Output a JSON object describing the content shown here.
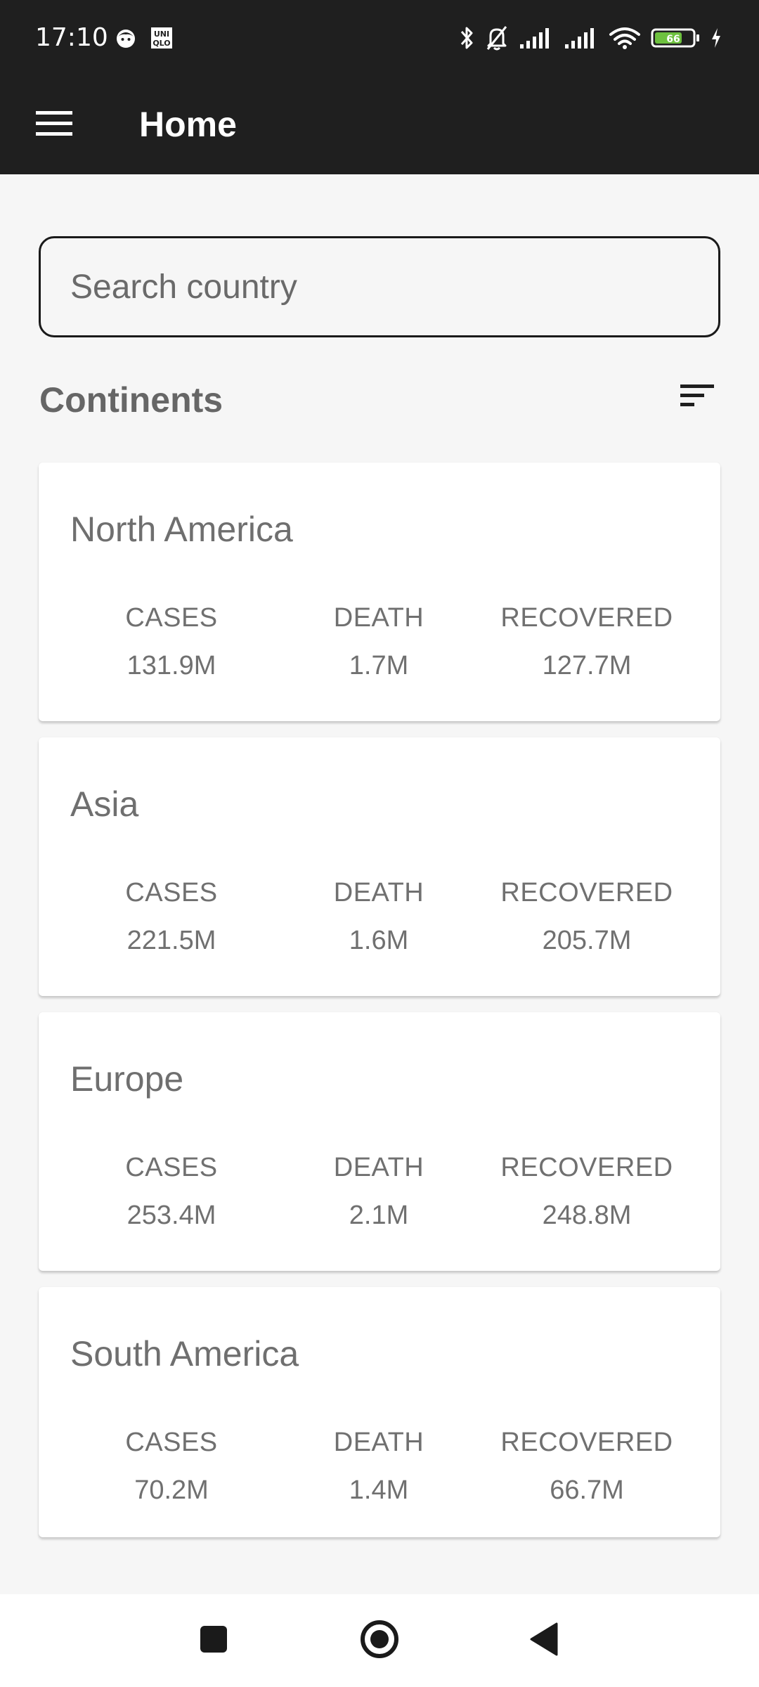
{
  "status_bar": {
    "time": "17:10",
    "left_icons": [
      "face-notification-icon",
      "uniqlo-notification-icon"
    ],
    "right_icons": [
      "bluetooth-icon",
      "bell-off-icon",
      "signal-icon",
      "signal-icon",
      "wifi-icon",
      "battery-icon",
      "charging-icon"
    ],
    "battery_level": "66",
    "battery_color": "#6ec13f",
    "uniqlo_text_top": "UNI",
    "uniqlo_text_bottom": "QLO"
  },
  "app_bar": {
    "title": "Home",
    "menu_icon": "hamburger-menu-icon"
  },
  "search": {
    "placeholder": "Search country",
    "value": ""
  },
  "section": {
    "title": "Continents",
    "sort_icon": "sort-icon"
  },
  "continents": [
    {
      "name": "North America",
      "cases_label": "CASES",
      "cases": "131.9M",
      "death_label": "DEATH",
      "death": "1.7M",
      "recovered_label": "RECOVERED",
      "recovered": "127.7M"
    },
    {
      "name": "Asia",
      "cases_label": "CASES",
      "cases": "221.5M",
      "death_label": "DEATH",
      "death": "1.6M",
      "recovered_label": "RECOVERED",
      "recovered": "205.7M"
    },
    {
      "name": "Europe",
      "cases_label": "CASES",
      "cases": "253.4M",
      "death_label": "DEATH",
      "death": "2.1M",
      "recovered_label": "RECOVERED",
      "recovered": "248.8M"
    },
    {
      "name": "South America",
      "cases_label": "CASES",
      "cases": "70.2M",
      "death_label": "DEATH",
      "death": "1.4M",
      "recovered_label": "RECOVERED",
      "recovered": "66.7M"
    }
  ],
  "nav_bar": {
    "buttons": [
      "recents-square-icon",
      "home-circle-icon",
      "back-triangle-icon"
    ]
  },
  "colors": {
    "app_bar_bg": "#1f1f1f",
    "page_bg": "#f6f6f6",
    "card_bg": "#ffffff",
    "text_gray": "#707070"
  }
}
